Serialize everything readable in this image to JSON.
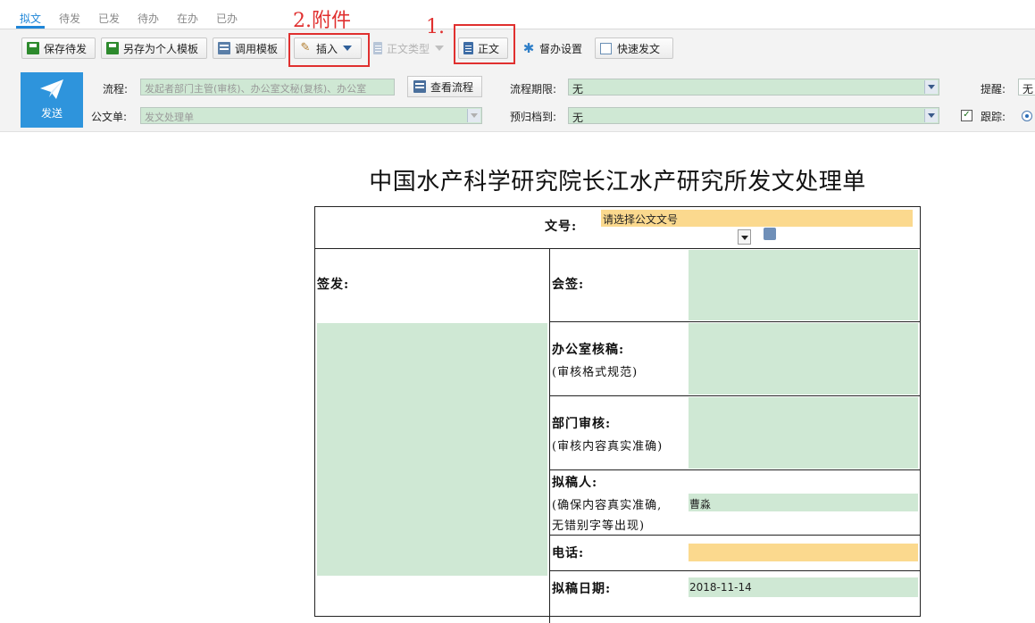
{
  "tabs": [
    "拟文",
    "待发",
    "已发",
    "待办",
    "在办",
    "已办"
  ],
  "toolbar": {
    "save_pending": "保存待发",
    "save_template": "另存为个人模板",
    "use_template": "调用模板",
    "insert": "插入",
    "body_type": "正文类型",
    "body": "正文",
    "supervise": "督办设置",
    "quick_send": "快速发文"
  },
  "annotations": {
    "step1": "1.",
    "step2": "2.附件",
    "color": "#e0302f"
  },
  "panel": {
    "send": "发送",
    "flow_label": "流程:",
    "flow_value": "发起者部门主管(审核)、办公室文秘(复核)、办公室",
    "view_flow": "查看流程",
    "form_label": "公文单:",
    "form_value": "发文处理单",
    "deadline_label": "流程期限:",
    "deadline_value": "无",
    "archive_label": "预归档到:",
    "archive_value": "无",
    "remind_label": "提醒:",
    "remind_value": "无",
    "track_label": "跟踪:"
  },
  "form": {
    "title": "中国水产科学研究院长江水产研究所发文处理单",
    "doc_no_label": "文号:",
    "doc_no_placeholder": "请选择公文文号",
    "sign_label": "签发:",
    "countersign_label": "会签:",
    "office_label": "办公室核稿:",
    "office_note": "(审核格式规范)",
    "dept_label": "部门审核:",
    "dept_note": "(审核内容真实准确)",
    "drafter_label": "拟稿人:",
    "drafter_note1": "(确保内容真实准确,",
    "drafter_note2": "无错别字等出现)",
    "drafter_value": "曹淼",
    "phone_label": "电话:",
    "date_label": "拟稿日期:",
    "date_value": "2018-11-14"
  },
  "colors": {
    "accent": "#1f86d8",
    "send_button": "#2e94dc",
    "field_green": "#cfe8d4",
    "field_yellow": "#fbd98e"
  }
}
